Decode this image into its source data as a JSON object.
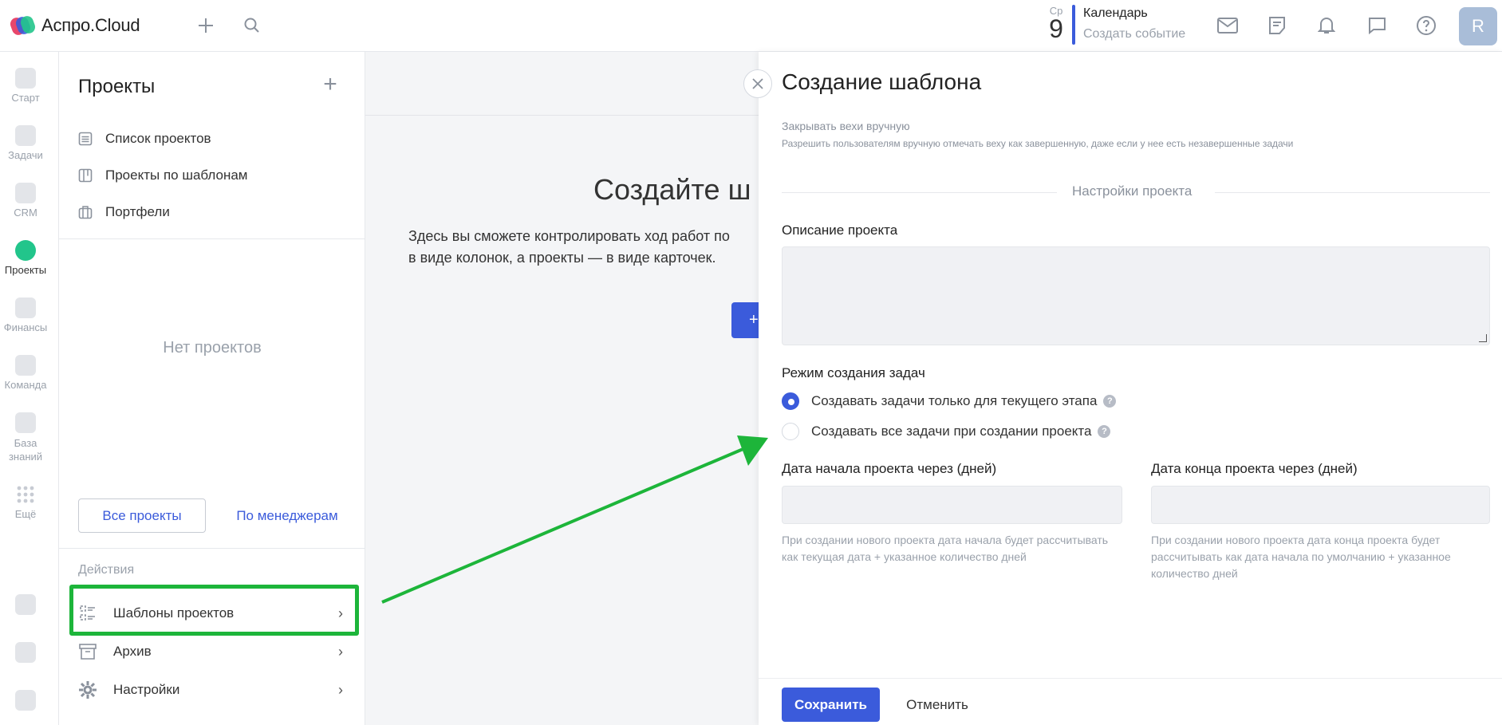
{
  "header": {
    "app_name": "Аспро.Cloud",
    "calendar_dow": "Ср",
    "calendar_day": "9",
    "calendar_title": "Календарь",
    "calendar_link": "Создать событие",
    "avatar_letter": "R"
  },
  "rail": {
    "items": [
      {
        "label": "Старт"
      },
      {
        "label": "Задачи"
      },
      {
        "label": "CRM"
      },
      {
        "label": "Проекты"
      },
      {
        "label": "Финансы"
      },
      {
        "label": "Команда"
      },
      {
        "label": "База знаний"
      },
      {
        "label": "Ещё"
      }
    ]
  },
  "sidebar": {
    "title": "Проекты",
    "nav": [
      {
        "label": "Список проектов"
      },
      {
        "label": "Проекты по шаблонам"
      },
      {
        "label": "Портфели"
      }
    ],
    "empty_text": "Нет проектов",
    "btn_all": "Все проекты",
    "btn_managers": "По менеджерам",
    "actions_label": "Действия",
    "actions": [
      {
        "label": "Шаблоны проектов"
      },
      {
        "label": "Архив"
      },
      {
        "label": "Настройки"
      }
    ]
  },
  "background": {
    "heading": "Создайте ш",
    "text_line1": "Здесь вы сможете контролировать ход работ по",
    "text_line2": "в виде колонок, а проекты — в виде карточек.",
    "button_glyph": "+"
  },
  "panel": {
    "title": "Создание шаблона",
    "close_milestones_label": "Закрывать вехи вручную",
    "close_milestones_desc": "Разрешить пользователям вручную отмечать веху как завершенную, даже если у нее есть незавершенные задачи",
    "section_title": "Настройки проекта",
    "description_label": "Описание проекта",
    "description_value": "",
    "task_mode_label": "Режим создания задач",
    "task_mode_options": [
      {
        "label": "Создавать задачи только для текущего этапа",
        "selected": true
      },
      {
        "label": "Создавать все задачи при создании проекта",
        "selected": false
      }
    ],
    "start_label": "Дата начала проекта через (дней)",
    "start_value": "",
    "start_hint": "При создании нового проекта дата начала будет рассчитывать как текущая дата + указанное количество дней",
    "end_label": "Дата конца проекта через (дней)",
    "end_value": "",
    "end_hint": "При создании нового проекта дата конца проекта будет рассчитывать как дата начала по умолчанию + указанное количество дней",
    "save_label": "Сохранить",
    "cancel_label": "Отменить"
  },
  "colors": {
    "accent": "#3b5bdb",
    "annotation_green": "#1db53a"
  }
}
